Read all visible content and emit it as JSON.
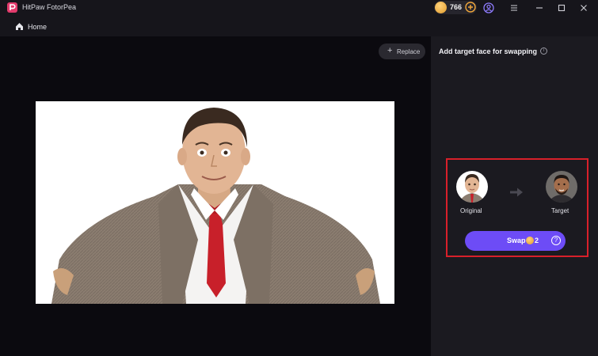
{
  "titlebar": {
    "app_name": "HitPaw FotorPea",
    "coin_count": "766",
    "icons": [
      "fotorpea-logo-icon",
      "coin-icon",
      "add-coins-icon",
      "account-icon",
      "menu-icon",
      "minimize-icon",
      "maximize-icon",
      "close-icon"
    ]
  },
  "nav": {
    "home_label": "Home"
  },
  "canvas": {
    "replace_label": "Replace"
  },
  "panel": {
    "title": "Add target face for swapping",
    "original_label": "Original",
    "target_label": "Target",
    "swap_label": "Swap",
    "swap_cost": "2"
  },
  "colors": {
    "accent": "#6d4cf6",
    "highlight_box": "#d8202a",
    "coin": "#e9a43a",
    "background": "#0b0a0f",
    "panel": "#1b1a20"
  }
}
